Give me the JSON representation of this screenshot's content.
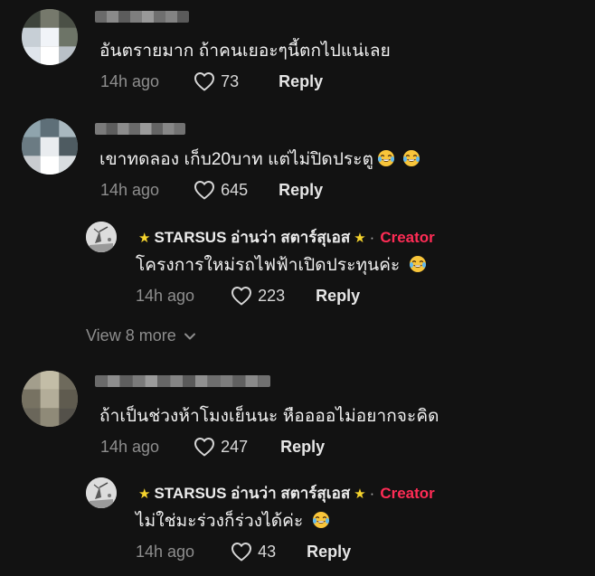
{
  "comments": [
    {
      "text": "อันตรายมาก ถ้าคนเยอะๆนี้ตกไปแน่เลย",
      "time": "14h ago",
      "likes": "73",
      "reply_label": "Reply"
    },
    {
      "text": "เขาทดลอง เก็บ20บาท แต่ไม่ปิดประตู",
      "time": "14h ago",
      "likes": "645",
      "reply_label": "Reply",
      "replies": [
        {
          "author": "STARSUS อ่านว่า สตาร์สุเอส",
          "star": "★",
          "separator": "·",
          "badge": "Creator",
          "text": "โครงการใหม่รถไฟฟ้าเปิดประทุนค่ะ",
          "time": "14h ago",
          "likes": "223",
          "reply_label": "Reply"
        }
      ],
      "view_more": "View 8 more"
    },
    {
      "text": "ถ้าเป็นช่วงห้าโมงเย็นนะ หืออออไม่อยากจะคิด",
      "time": "14h ago",
      "likes": "247",
      "reply_label": "Reply",
      "replies": [
        {
          "author": "STARSUS อ่านว่า สตาร์สุเอส",
          "star": "★",
          "separator": "·",
          "badge": "Creator",
          "text": "ไม่ใช่มะร่วงก็ร่วงได้ค่ะ",
          "time": "14h ago",
          "likes": "43",
          "reply_label": "Reply"
        }
      ]
    }
  ],
  "colors": {
    "background": "#121212",
    "creator_badge": "#fe2c55",
    "star": "#f6d42d",
    "muted": "#8e8e8e"
  },
  "icons": {
    "like": "heart-outline-icon",
    "emoji": "laughing-tears-emoji-icon",
    "expand": "chevron-down-icon"
  }
}
